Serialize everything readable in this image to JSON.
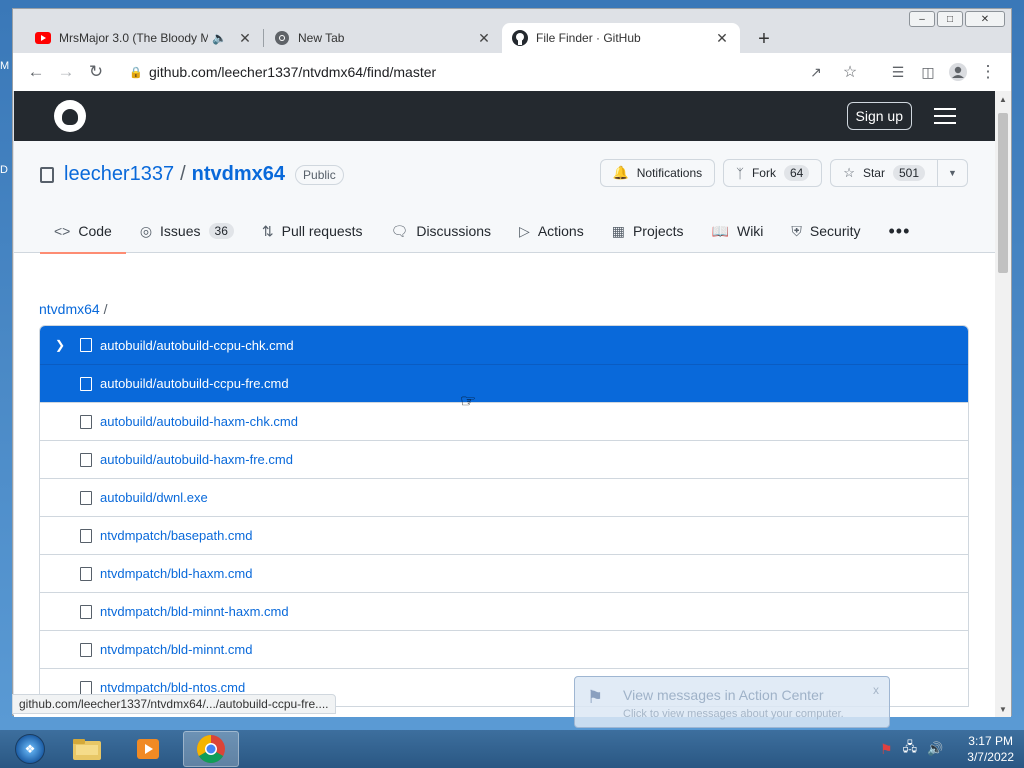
{
  "desktop": {
    "glyph_top": "M",
    "glyph_mid": "D"
  },
  "window": {
    "minimize": "–",
    "maximize": "□",
    "close": "✕"
  },
  "tabs": [
    {
      "title": "MrsMajor 3.0 (The Bloody M",
      "icon": "youtube-icon",
      "audio": true
    },
    {
      "title": "New Tab",
      "icon": "chrome-icon"
    },
    {
      "title": "File Finder · GitHub",
      "icon": "github-icon",
      "active": true
    }
  ],
  "toolbar": {
    "url": "github.com/leecher1337/ntvdmx64/find/master"
  },
  "gh": {
    "signup": "Sign up"
  },
  "repo": {
    "owner": "leecher1337",
    "separator": "/",
    "name": "ntvdmx64",
    "visibility": "Public",
    "notifications": "Notifications",
    "fork_label": "Fork",
    "fork_count": "64",
    "star_label": "Star",
    "star_count": "501"
  },
  "nav": {
    "code": "Code",
    "issues": "Issues",
    "issues_count": "36",
    "pulls": "Pull requests",
    "discussions": "Discussions",
    "actions": "Actions",
    "projects": "Projects",
    "wiki": "Wiki",
    "security": "Security",
    "more": "•••"
  },
  "finder": {
    "crumb": "ntvdmx64",
    "crumb_sep": "/",
    "files": [
      "autobuild/autobuild-ccpu-chk.cmd",
      "autobuild/autobuild-ccpu-fre.cmd",
      "autobuild/autobuild-haxm-chk.cmd",
      "autobuild/autobuild-haxm-fre.cmd",
      "autobuild/dwnl.exe",
      "ntvdmpatch/basepath.cmd",
      "ntvdmpatch/bld-haxm.cmd",
      "ntvdmpatch/bld-minnt-haxm.cmd",
      "ntvdmpatch/bld-minnt.cmd",
      "ntvdmpatch/bld-ntos.cmd"
    ]
  },
  "status_url": "github.com/leecher1337/ntvdmx64/.../autobuild-ccpu-fre....",
  "notification": {
    "title": "View messages in Action Center",
    "subtitle": "Click to view messages about your computer.",
    "close": "x"
  },
  "clock": {
    "time": "3:17 PM",
    "date": "3/7/2022"
  }
}
